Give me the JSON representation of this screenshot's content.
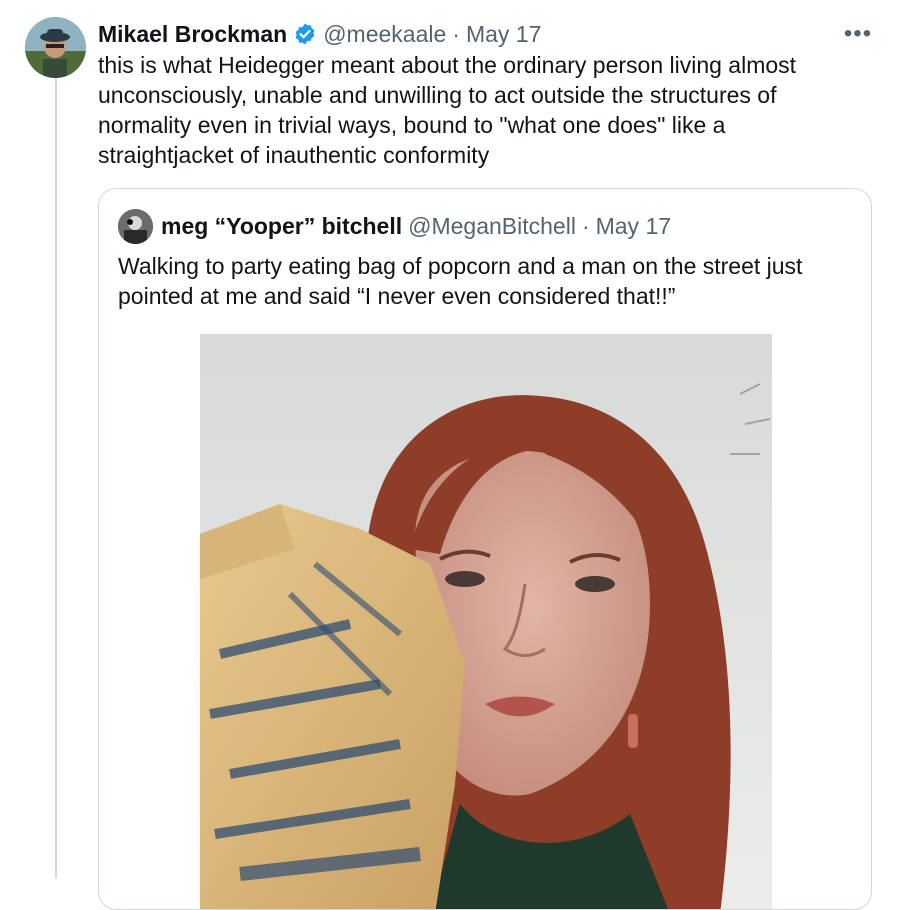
{
  "tweet": {
    "author": {
      "display_name": "Mikael Brockman",
      "handle": "@meekaale",
      "verified": true
    },
    "separator": "·",
    "date": "May 17",
    "more_label": "•••",
    "text": "this is what Heidegger meant about the ordinary person living almost unconsciously, unable and unwilling to act outside the structures of normality even in trivial ways, bound to \"what one does\" like a straightjacket of inauthentic conformity"
  },
  "quoted_tweet": {
    "author": {
      "display_name": "meg “Yooper” bitchell",
      "handle": "@MeganBitchell"
    },
    "separator": "·",
    "date": "May 17",
    "text": "Walking to party eating bag of popcorn and a man on the street just pointed at me and said “I never even considered that!!”",
    "media": "photo"
  },
  "colors": {
    "primary_text": "#0f1419",
    "secondary_text": "#536471",
    "border": "#cfd9de",
    "verified_blue": "#1d9bf0"
  }
}
